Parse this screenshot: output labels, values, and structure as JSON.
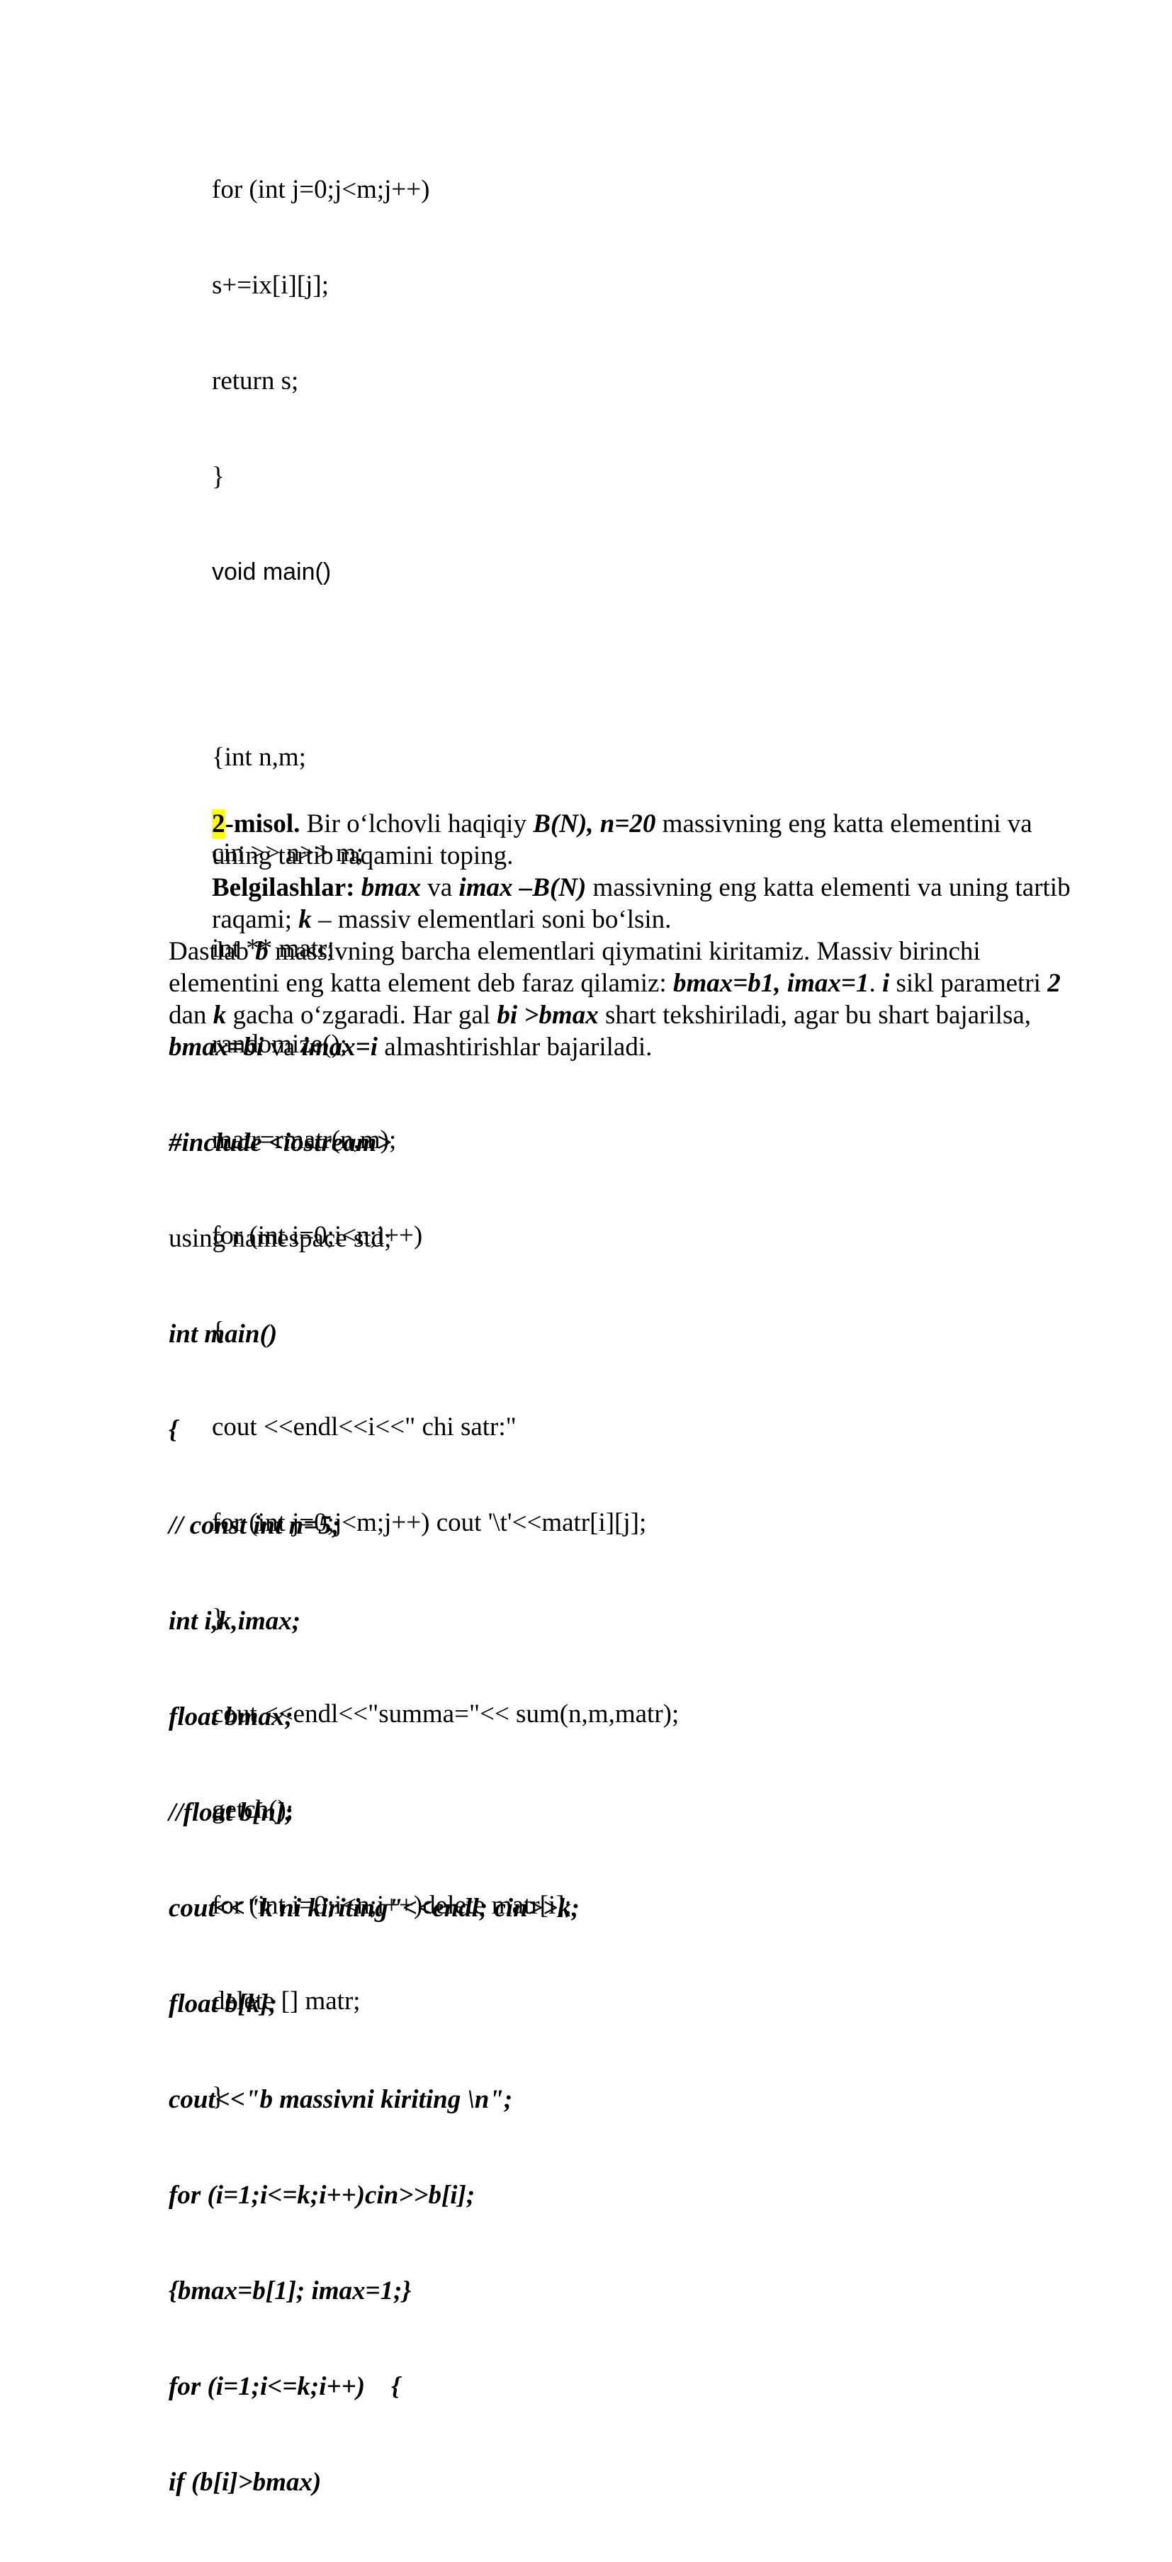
{
  "code_top": [
    "for (int j=0;j<m;j++)",
    "s+=ix[i][j];",
    "return s;",
    "}"
  ],
  "void_main": "void main()",
  "code_main": [
    "{int n,m;",
    "cin >> n>> m;",
    "int ** matr;",
    "randomize();",
    "matr=rmatr(n,m);",
    "for (int i=0;i<n;i++)",
    "{",
    "cout <<endl<<i<<\" chi satr:\"",
    "for (int j=0;j<m;j++) cout '\\t'<<matr[i][j];",
    "}",
    "cout <<endl<<\"summa=\"<< sum(n,m,matr);",
    "getch();",
    "for (int i=0;i<n;i++)delete matr[i];",
    "delete [] matr;",
    "}"
  ],
  "para1": {
    "num": "2",
    "label": "-misol.",
    "t1": " Bir o‘lchovli haqiqiy ",
    "b1": "B(N), n=20",
    "t2": " massivning eng katta elementini va uning tartib raqamini toping."
  },
  "para2": {
    "label": "Belgilashlar:",
    "b1": "bmax",
    "t1": " va ",
    "b2": "imax –B(N)",
    "t2": " massivning eng katta elementi va uning tartib raqami; ",
    "b3": "k",
    "t3": " – massiv elementlari soni bo‘lsin."
  },
  "para3": {
    "t1": "Dastlab ",
    "b1": "b",
    "t2": " massivning barcha elementlari qiymatini kiritamiz. Massiv birinchi elementini eng katta element deb faraz qilamiz: ",
    "b2": "bmax=b1, imax=1",
    "t3": ". ",
    "b3": "i",
    "t4": " sikl parametri ",
    "b4": "2",
    "t5": " dan ",
    "b5": "k",
    "t6": " gacha o‘zgaradi. Har gal ",
    "b6": "bi >bmax",
    "t7": " shart tekshiriladi, agar bu shart bajarilsa, ",
    "b7": "bmax=bi",
    "t8": " va ",
    "b8": "imax=i",
    "t9": " almashtirishlar bajariladi."
  },
  "code_bottom": [
    {
      "text": "#include <iostream>",
      "style": "bold-italic"
    },
    {
      "text": "using namespace std;",
      "style": "plain"
    },
    {
      "text": "int main()",
      "style": "bold-italic"
    },
    {
      "text": "{",
      "style": "bold-italic"
    },
    {
      "text": "// const int n=5;",
      "style": "bold-italic"
    },
    {
      "text": "int i,k,imax;",
      "style": "bold-italic"
    },
    {
      "text": "float bmax;",
      "style": "bold-italic"
    },
    {
      "text": "//float b[n];",
      "style": "bold-italic"
    },
    {
      "text": "cout<<\"k ni kiriting\"<<endl; cin>>k;",
      "style": "bold-italic"
    },
    {
      "text": "float b[k];",
      "style": "bold-italic"
    },
    {
      "text": "cout<<\"b massivni kiriting \\n\";",
      "style": "bold-italic"
    },
    {
      "text": "for (i=1;i<=k;i++)cin>>b[i];",
      "style": "bold-italic"
    },
    {
      "text": "{bmax=b[1]; imax=1;}",
      "style": "bold-italic"
    },
    {
      "text": "for (i=1;i<=k;i++)    {",
      "style": "bold-italic"
    },
    {
      "text": "if (b[i]>bmax)",
      "style": "bold-italic"
    }
  ],
  "highlight_color": "#ffff00"
}
